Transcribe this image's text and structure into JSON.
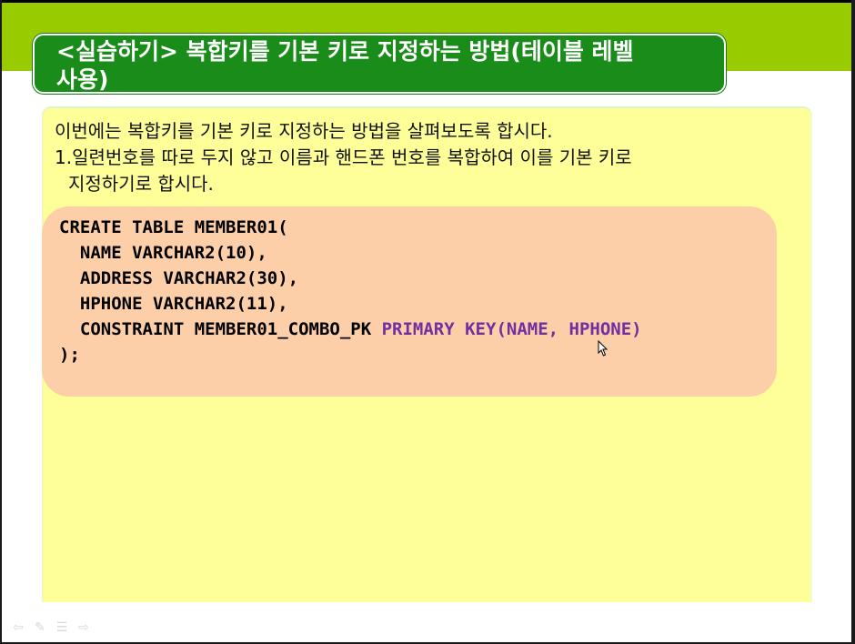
{
  "slide": {
    "title": "<실습하기> 복합키를 기본 키로 지정하는 방법(테이블 레벨 사용)",
    "title_line1": "<실습하기> 복합키를 기본 키로 지정하는 방법(테이블 레벨",
    "title_line2": "사용)",
    "desc_line1": "이번에는 복합키를 기본 키로 지정하는 방법을 살펴보도록 합시다.",
    "desc_line2": "1.일련번호를 따로 두지 않고 이름과 핸드폰 번호를 복합하여 이를 기본 키로",
    "desc_line3": "지정하기로 합시다.",
    "code": {
      "line1": "CREATE TABLE MEMBER01(",
      "line2": "  NAME VARCHAR2(10),",
      "line3": "  ADDRESS VARCHAR2(30),",
      "line4": "  HPHONE VARCHAR2(11),",
      "line5_a": "  CONSTRAINT MEMBER01_COMBO_PK ",
      "line5_b": "PRIMARY KEY(NAME, HPHONE)",
      "line6": ");"
    }
  },
  "footer": {
    "icons": [
      "prev-arrow-icon",
      "pen-icon",
      "menu-icon",
      "next-arrow-icon"
    ]
  },
  "colors": {
    "band": "#99cc00",
    "title_bg": "#1a8c1a",
    "panel": "#ffff99",
    "code_bg": "#fdcfa9",
    "keyword": "#7030a0"
  }
}
